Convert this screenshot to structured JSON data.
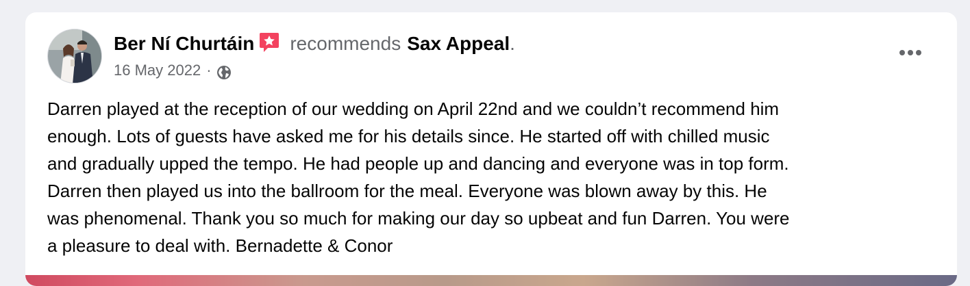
{
  "post": {
    "author": "Ber Ní Churtáin",
    "action": "recommends",
    "page": "Sax Appeal",
    "period": ".",
    "date": "16 May 2022",
    "separator": "·",
    "privacy_icon": "globe-icon",
    "badge_icon": "recommendation-star-icon",
    "more_icon": "more-options-icon",
    "body_lines": [
      "Darren played at the reception of our wedding on April 22nd and we couldn’t recommend him",
      "enough. Lots of guests have asked me for his details since. He started off with chilled music",
      "and gradually upped the tempo. He had people up and dancing and everyone was in top form.",
      "Darren then played us into the ballroom for the meal. Everyone was blown away by this. He",
      "was phenomenal. Thank you so much for making our day so upbeat and fun Darren. You were",
      "a pleasure to deal with. Bernadette & Conor"
    ]
  },
  "colors": {
    "background": "#eff0f4",
    "card": "#ffffff",
    "primary_text": "#050505",
    "secondary_text": "#65676b",
    "badge": "#f3425f"
  }
}
